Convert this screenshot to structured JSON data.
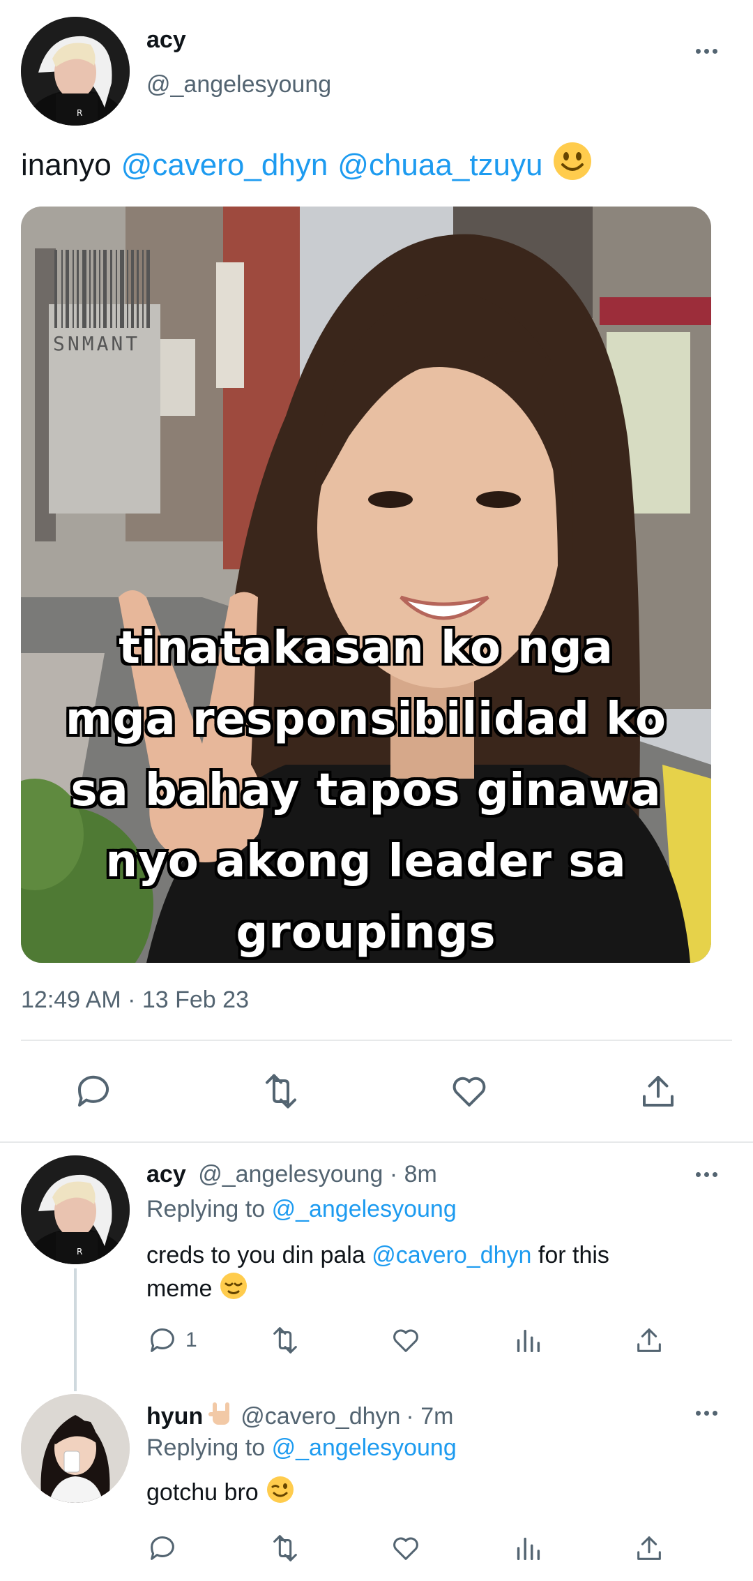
{
  "main_tweet": {
    "display_name": "acy",
    "handle": "@_angelesyoung",
    "text_prefix": "inanyo",
    "mentions": [
      "@cavero_dhyn",
      "@chuaa_tzuyu"
    ],
    "emoji": "slightly-smiling-face",
    "image": {
      "watermark": "SNMANT",
      "caption_lines": [
        "tinatakasan ko nga",
        "mga responsibilidad ko",
        "sa bahay tapos ginawa",
        "nyo akong leader sa",
        "groupings"
      ]
    },
    "timestamp": "12:49 AM · 13 Feb 23"
  },
  "replies": [
    {
      "display_name": "acy",
      "handle": "@_angelesyoung",
      "time": "· 8m",
      "replying_label": "Replying to",
      "replying_handle": "@_angelesyoung",
      "text_before": "creds to you din pala",
      "mention": "@cavero_dhyn",
      "text_after": "for this",
      "text_line2": "meme",
      "emoji": "relieved-face",
      "reply_count": "1"
    },
    {
      "display_name": "hyun",
      "name_emoji": "rock-on-hand",
      "handle": "@cavero_dhyn",
      "time": "· 7m",
      "replying_label": "Replying to",
      "replying_handle": "@_angelesyoung",
      "text": "gotchu bro",
      "emoji": "winking-face"
    }
  ],
  "colors": {
    "link": "#1d9bf0",
    "muted": "#536471",
    "divider": "#e7e9ea"
  }
}
